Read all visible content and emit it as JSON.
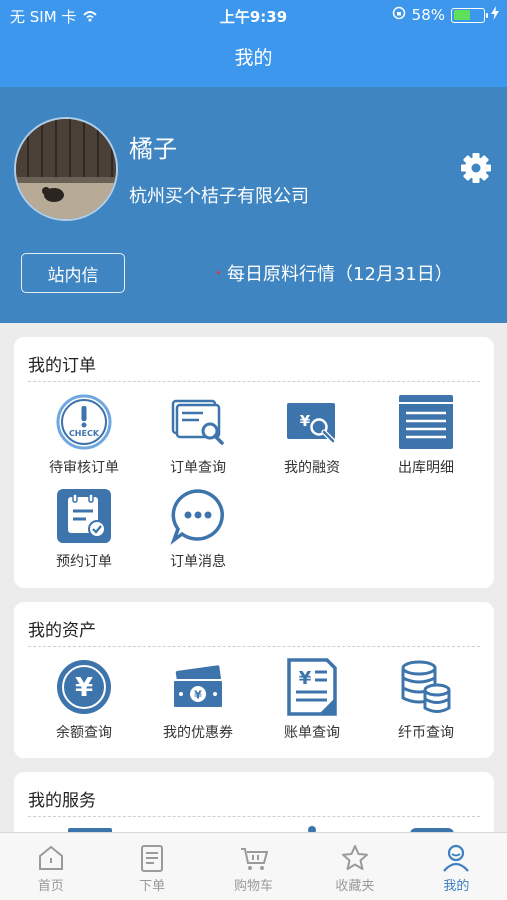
{
  "status_bar": {
    "carrier": "无 SIM 卡",
    "time": "上午9:39",
    "battery": "58%",
    "battery_level": 0.58
  },
  "nav": {
    "title": "我的"
  },
  "profile": {
    "name": "橘子",
    "company": "杭州买个桔子有限公司",
    "message_button": "站内信",
    "daily_market": "每日原料行情（12月31日）"
  },
  "orders": {
    "title": "我的订单",
    "items": [
      {
        "label": "待审核订单",
        "icon": "check-icon"
      },
      {
        "label": "订单查询",
        "icon": "order-search-icon"
      },
      {
        "label": "我的融资",
        "icon": "financing-icon"
      },
      {
        "label": "出库明细",
        "icon": "outbound-detail-icon"
      },
      {
        "label": "预约订单",
        "icon": "reservation-icon"
      },
      {
        "label": "订单消息",
        "icon": "message-bubble-icon"
      }
    ]
  },
  "assets": {
    "title": "我的资产",
    "items": [
      {
        "label": "余额查询",
        "icon": "yen-coin-icon"
      },
      {
        "label": "我的优惠券",
        "icon": "coupon-icon"
      },
      {
        "label": "账单查询",
        "icon": "bill-icon"
      },
      {
        "label": "纤币查询",
        "icon": "coin-stack-icon"
      }
    ]
  },
  "services": {
    "title": "我的服务"
  },
  "tab_bar": {
    "items": [
      {
        "label": "首页",
        "icon": "home-icon"
      },
      {
        "label": "下单",
        "icon": "order-form-icon"
      },
      {
        "label": "购物车",
        "icon": "cart-icon"
      },
      {
        "label": "收藏夹",
        "icon": "star-icon"
      },
      {
        "label": "我的",
        "icon": "profile-icon"
      }
    ],
    "active": "我的"
  },
  "colors": {
    "primary": "#3d97ec",
    "profile_bg": "#3f85c2",
    "icon_blue": "#3d74ac",
    "tab_active": "#3d7fc1"
  }
}
